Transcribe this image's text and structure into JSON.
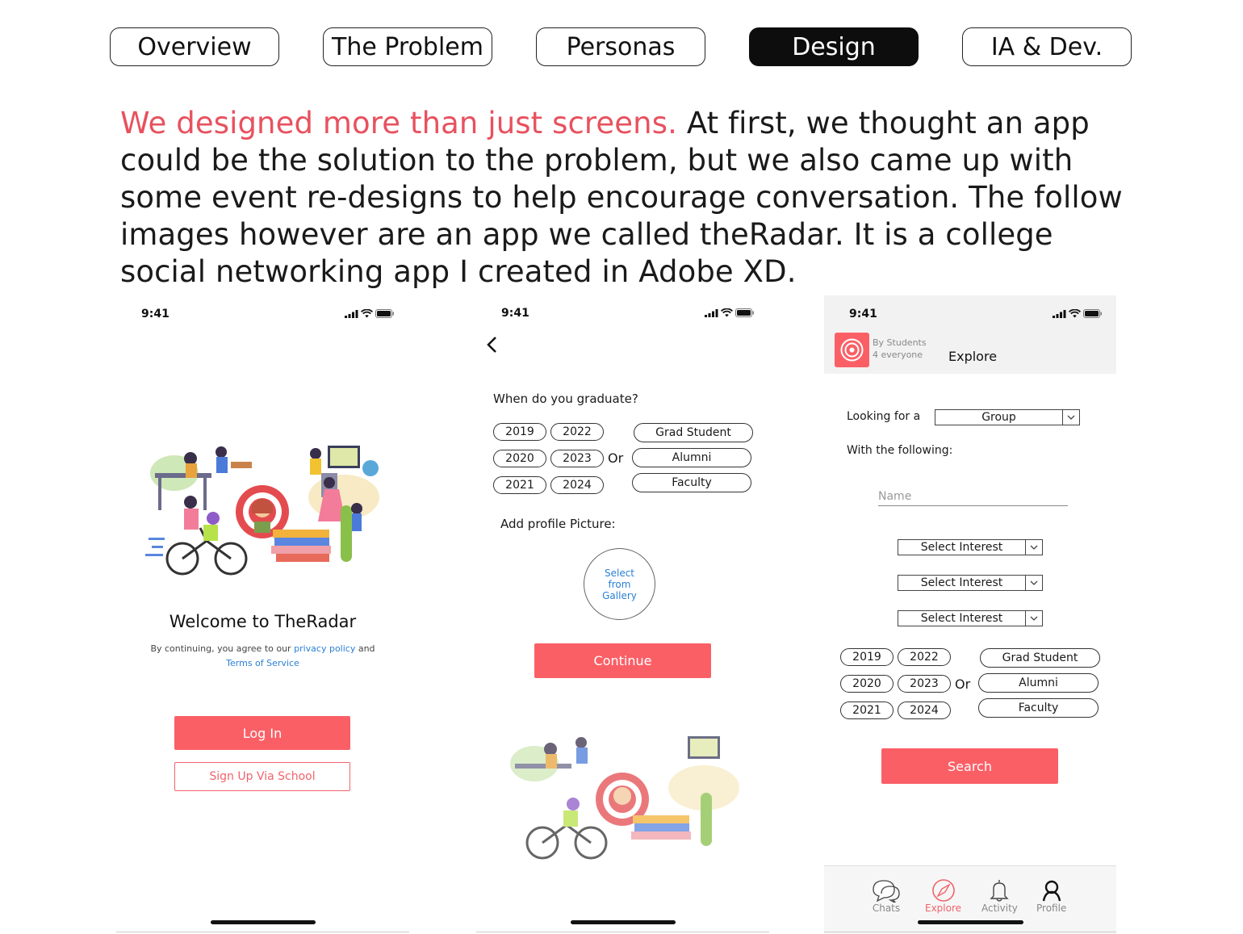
{
  "tabs": [
    {
      "label": "Overview",
      "active": false
    },
    {
      "label": "The Problem",
      "active": false
    },
    {
      "label": "Personas",
      "active": false
    },
    {
      "label": "Design",
      "active": true
    },
    {
      "label": "IA & Dev.",
      "active": false
    }
  ],
  "intro": {
    "accent": "We designed more than just screens.",
    "body": " At first, we thought an app could be the solution to the problem, but we also came up with some event re-designs to help encourage conversation. The follow images however are an app we called theRadar. It is a college social networking app I created in Adobe XD."
  },
  "colors": {
    "accent": "#fb5f66",
    "link": "#2a7fd4",
    "active_tab": "#0d0d0d"
  },
  "screen1": {
    "time": "9:41",
    "welcome": "Welcome to TheRadar",
    "terms_prefix": "By continuing, you agree to our",
    "privacy_link": "privacy policy",
    "and": "and",
    "terms_link": "Terms of Service",
    "login_label": "Log In",
    "signup_label": "Sign Up Via School"
  },
  "screen2": {
    "time": "9:41",
    "question": "When do you graduate?",
    "years": [
      "2019",
      "2022",
      "2020",
      "2023",
      "2021",
      "2024"
    ],
    "or": "Or",
    "roles": [
      "Grad Student",
      "Alumni",
      "Faculty"
    ],
    "profile_label": "Add profile Picture:",
    "gallery_label": [
      "Select",
      "from",
      "Gallery"
    ],
    "continue_label": "Continue"
  },
  "screen3": {
    "time": "9:41",
    "brand_line1": "By Students",
    "brand_line2": "4 everyone",
    "header_title": "Explore",
    "looking_for": "Looking for a",
    "group_select": "Group",
    "with_following": "With the following:",
    "name_placeholder": "Name",
    "interest_selects": [
      "Select Interest",
      "Select Interest",
      "Select Interest"
    ],
    "years": [
      "2019",
      "2022",
      "2020",
      "2023",
      "2021",
      "2024"
    ],
    "or": "Or",
    "roles": [
      "Grad Student",
      "Alumni",
      "Faculty"
    ],
    "search_label": "Search",
    "nav": [
      {
        "label": "Chats",
        "icon": "chat-icon"
      },
      {
        "label": "Explore",
        "icon": "compass-icon"
      },
      {
        "label": "Activity",
        "icon": "bell-icon"
      },
      {
        "label": "Profile",
        "icon": "profile-icon"
      }
    ]
  }
}
